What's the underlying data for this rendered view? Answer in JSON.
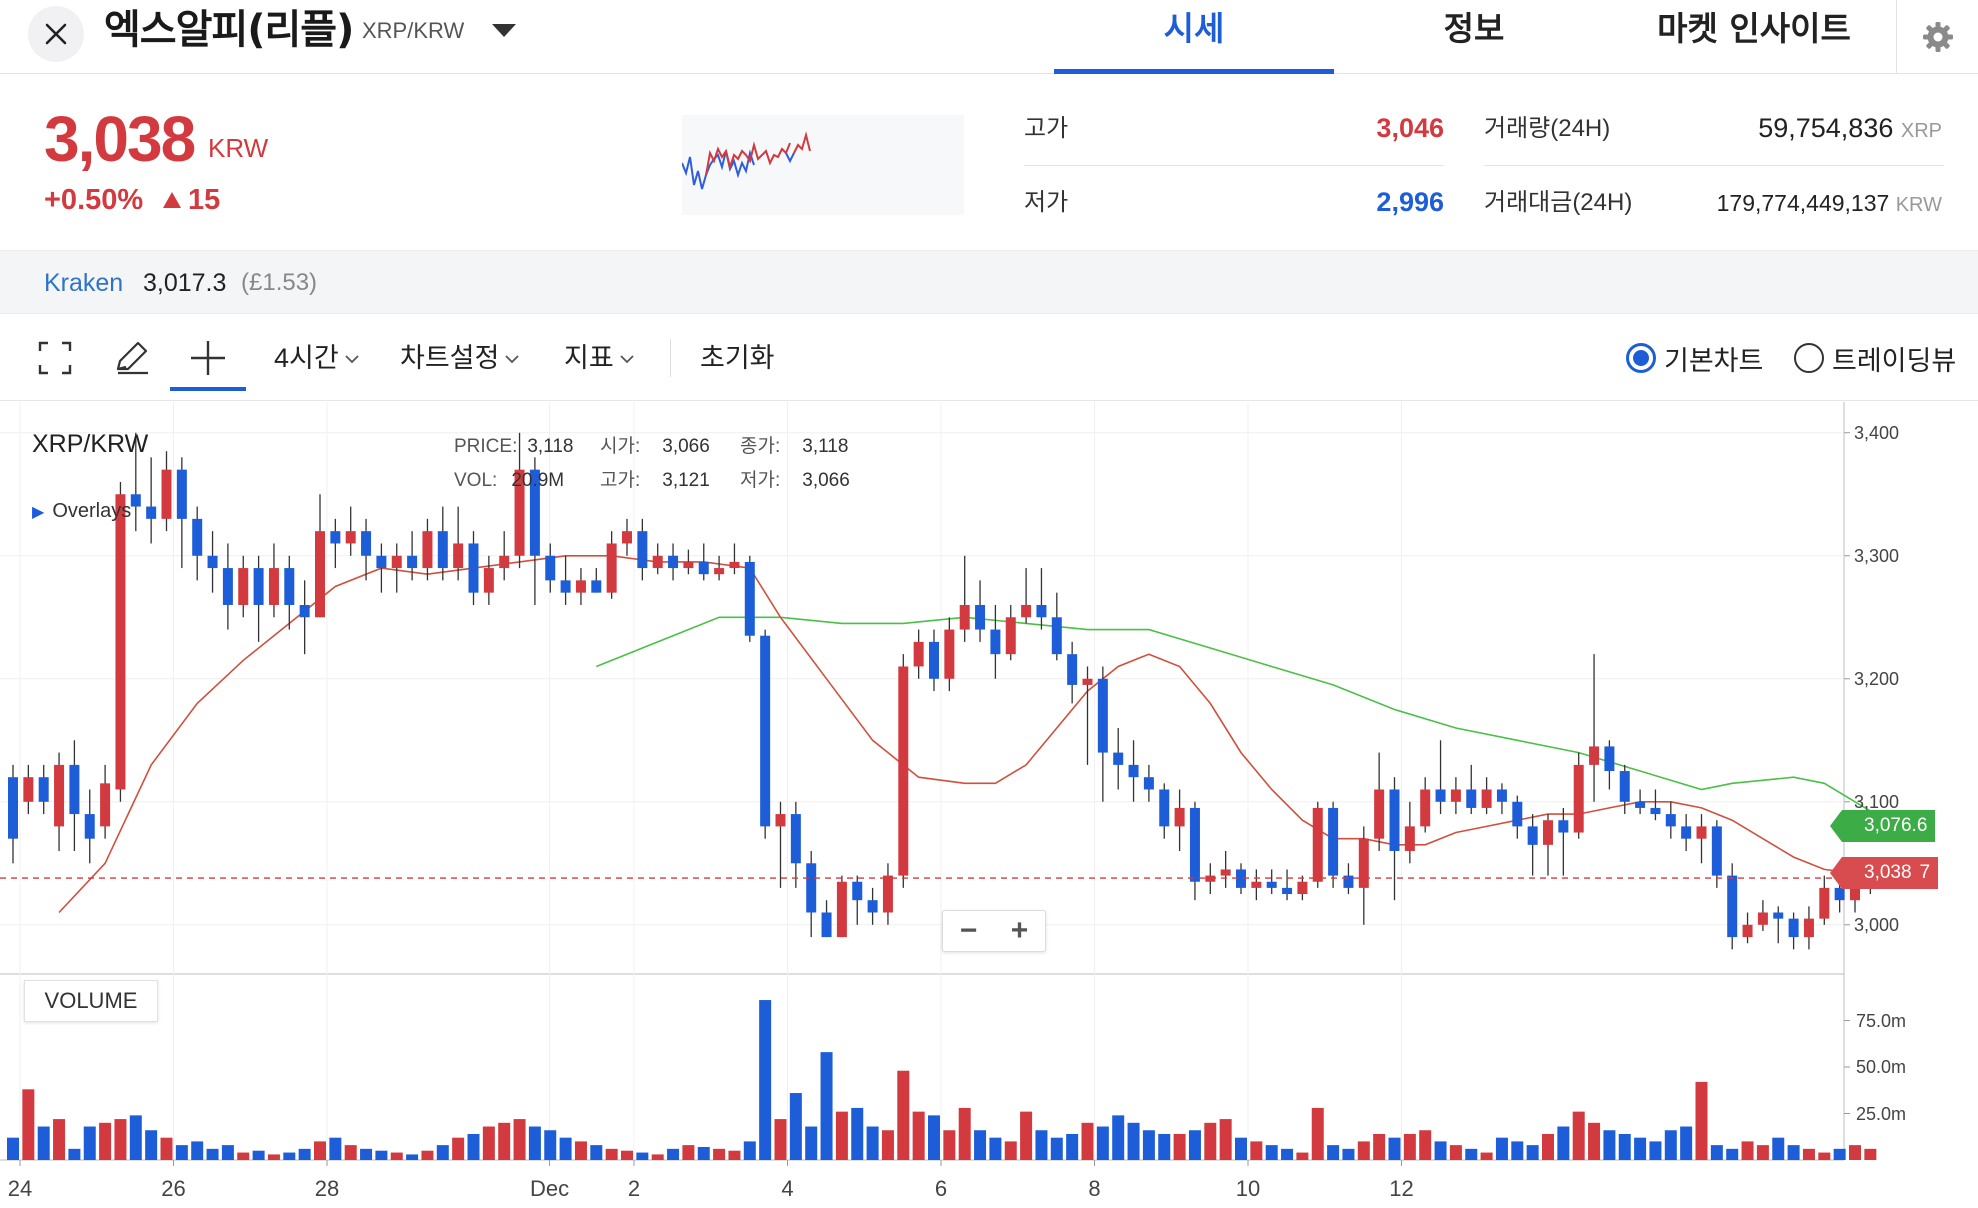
{
  "header": {
    "coin_name": "엑스알피(리플)",
    "pair": "XRP/KRW",
    "tabs": [
      {
        "label": "시세",
        "active": true
      },
      {
        "label": "정보",
        "active": false
      },
      {
        "label": "마켓 인사이트",
        "active": false
      }
    ]
  },
  "price": {
    "current": "3,038",
    "unit": "KRW",
    "change_pct": "+0.50%",
    "change_abs": "15",
    "high_label": "고가",
    "high_value": "3,046",
    "low_label": "저가",
    "low_value": "2,996",
    "volume_label": "거래량(24H)",
    "volume_value": "59,754,836",
    "volume_unit": "XRP",
    "amount_label": "거래대금(24H)",
    "amount_value": "179,774,449,137",
    "amount_unit": "KRW"
  },
  "exchange": {
    "name": "Kraken",
    "price": "3,017.3",
    "sub": "(£1.53)"
  },
  "toolbar": {
    "interval": "4시간",
    "chart_settings": "차트설정",
    "indicators": "지표",
    "reset": "초기화",
    "radio_basic": "기본차트",
    "radio_tradingview": "트레이딩뷰",
    "selected_view": "기본차트"
  },
  "chart": {
    "symbol": "XRP/KRW",
    "overlays_label": "Overlays",
    "ohlc": {
      "price_key": "PRICE:",
      "price": "3,118",
      "open_key": "시가:",
      "open": "3,066",
      "close_key": "종가:",
      "close": "3,118",
      "vol_key": "VOL:",
      "vol": "20.9M",
      "high_key": "고가:",
      "high": "3,121",
      "low_key": "저가:",
      "low": "3,066"
    },
    "volume_label": "VOLUME",
    "zoom_minus": "−",
    "zoom_plus": "+",
    "price_tag_ma": "3,076.6",
    "price_tag_last": "3,038",
    "price_tag_last_suffix": "7"
  },
  "colors": {
    "up": "#d23a3f",
    "down": "#1d5ed8",
    "accent": "#1d5ed8",
    "ma_short": "#d0503e",
    "ma_long": "#4bbf47"
  },
  "chart_data": {
    "type": "candlestick",
    "title": "XRP/KRW",
    "x_ticks": [
      "24",
      "26",
      "28",
      "Dec",
      "2",
      "4",
      "6",
      "8",
      "10",
      "12"
    ],
    "y_ticks": [
      "3,400",
      "3,300",
      "3,200",
      "3,100",
      "3,000"
    ],
    "volume_ticks": [
      "75.0m",
      "50.0m",
      "25.0m"
    ],
    "ylim": [
      2960,
      3425
    ],
    "volume_ylim": [
      0,
      100
    ],
    "current_price": 3038,
    "candles": [
      [
        3120,
        3070,
        3130,
        3050
      ],
      [
        3100,
        3120,
        3130,
        3090
      ],
      [
        3120,
        3100,
        3130,
        3090
      ],
      [
        3080,
        3130,
        3140,
        3060
      ],
      [
        3130,
        3090,
        3150,
        3060
      ],
      [
        3090,
        3070,
        3110,
        3050
      ],
      [
        3080,
        3115,
        3130,
        3070
      ],
      [
        3110,
        3350,
        3360,
        3100
      ],
      [
        3350,
        3340,
        3400,
        3320
      ],
      [
        3340,
        3330,
        3380,
        3310
      ],
      [
        3330,
        3370,
        3385,
        3320
      ],
      [
        3370,
        3330,
        3380,
        3290
      ],
      [
        3330,
        3300,
        3340,
        3280
      ],
      [
        3300,
        3290,
        3320,
        3270
      ],
      [
        3290,
        3260,
        3310,
        3240
      ],
      [
        3260,
        3290,
        3300,
        3250
      ],
      [
        3290,
        3260,
        3300,
        3230
      ],
      [
        3260,
        3290,
        3310,
        3250
      ],
      [
        3290,
        3260,
        3300,
        3240
      ],
      [
        3260,
        3250,
        3280,
        3220
      ],
      [
        3250,
        3320,
        3350,
        3250
      ],
      [
        3320,
        3310,
        3330,
        3290
      ],
      [
        3310,
        3320,
        3340,
        3300
      ],
      [
        3320,
        3300,
        3330,
        3280
      ],
      [
        3300,
        3290,
        3310,
        3270
      ],
      [
        3290,
        3300,
        3310,
        3270
      ],
      [
        3300,
        3290,
        3320,
        3280
      ],
      [
        3290,
        3320,
        3330,
        3280
      ],
      [
        3320,
        3290,
        3340,
        3280
      ],
      [
        3290,
        3310,
        3340,
        3280
      ],
      [
        3310,
        3270,
        3320,
        3260
      ],
      [
        3270,
        3290,
        3300,
        3260
      ],
      [
        3290,
        3300,
        3320,
        3280
      ],
      [
        3300,
        3370,
        3400,
        3290
      ],
      [
        3370,
        3300,
        3380,
        3260
      ],
      [
        3300,
        3280,
        3310,
        3270
      ],
      [
        3280,
        3270,
        3300,
        3260
      ],
      [
        3270,
        3280,
        3290,
        3260
      ],
      [
        3280,
        3270,
        3290,
        3270
      ],
      [
        3270,
        3310,
        3320,
        3265
      ],
      [
        3310,
        3320,
        3330,
        3300
      ],
      [
        3320,
        3290,
        3330,
        3280
      ],
      [
        3290,
        3300,
        3310,
        3285
      ],
      [
        3300,
        3290,
        3310,
        3280
      ],
      [
        3290,
        3295,
        3305,
        3285
      ],
      [
        3295,
        3285,
        3310,
        3280
      ],
      [
        3285,
        3290,
        3300,
        3280
      ],
      [
        3290,
        3295,
        3310,
        3285
      ],
      [
        3295,
        3235,
        3300,
        3230
      ],
      [
        3235,
        3080,
        3240,
        3070
      ],
      [
        3080,
        3090,
        3100,
        3030
      ],
      [
        3090,
        3050,
        3100,
        3030
      ],
      [
        3050,
        3010,
        3060,
        2990
      ],
      [
        3010,
        2990,
        3020,
        2990
      ],
      [
        2990,
        3035,
        3040,
        2990
      ],
      [
        3035,
        3020,
        3040,
        3000
      ],
      [
        3020,
        3010,
        3030,
        3000
      ],
      [
        3010,
        3040,
        3050,
        3000
      ],
      [
        3040,
        3210,
        3220,
        3030
      ],
      [
        3210,
        3230,
        3240,
        3200
      ],
      [
        3230,
        3200,
        3240,
        3190
      ],
      [
        3200,
        3240,
        3250,
        3190
      ],
      [
        3240,
        3260,
        3300,
        3230
      ],
      [
        3260,
        3240,
        3280,
        3230
      ],
      [
        3240,
        3220,
        3260,
        3200
      ],
      [
        3220,
        3250,
        3260,
        3215
      ],
      [
        3250,
        3260,
        3290,
        3245
      ],
      [
        3260,
        3250,
        3290,
        3240
      ],
      [
        3250,
        3220,
        3270,
        3215
      ],
      [
        3220,
        3195,
        3230,
        3180
      ],
      [
        3195,
        3200,
        3210,
        3130
      ],
      [
        3200,
        3140,
        3210,
        3100
      ],
      [
        3140,
        3130,
        3160,
        3110
      ],
      [
        3130,
        3120,
        3150,
        3100
      ],
      [
        3120,
        3110,
        3130,
        3100
      ],
      [
        3110,
        3080,
        3115,
        3070
      ],
      [
        3080,
        3095,
        3110,
        3060
      ],
      [
        3095,
        3035,
        3100,
        3020
      ],
      [
        3035,
        3040,
        3050,
        3025
      ],
      [
        3040,
        3045,
        3060,
        3030
      ],
      [
        3045,
        3030,
        3050,
        3025
      ],
      [
        3030,
        3035,
        3045,
        3020
      ],
      [
        3035,
        3030,
        3045,
        3025
      ],
      [
        3030,
        3025,
        3045,
        3020
      ],
      [
        3025,
        3035,
        3040,
        3020
      ],
      [
        3035,
        3095,
        3100,
        3030
      ],
      [
        3095,
        3040,
        3100,
        3030
      ],
      [
        3040,
        3030,
        3050,
        3025
      ],
      [
        3030,
        3070,
        3080,
        3000
      ],
      [
        3070,
        3110,
        3140,
        3060
      ],
      [
        3110,
        3060,
        3120,
        3020
      ],
      [
        3060,
        3080,
        3100,
        3050
      ],
      [
        3080,
        3110,
        3120,
        3075
      ],
      [
        3110,
        3100,
        3150,
        3090
      ],
      [
        3100,
        3110,
        3120,
        3090
      ],
      [
        3110,
        3095,
        3130,
        3090
      ],
      [
        3095,
        3110,
        3120,
        3090
      ],
      [
        3110,
        3100,
        3115,
        3090
      ],
      [
        3100,
        3080,
        3105,
        3070
      ],
      [
        3080,
        3065,
        3090,
        3040
      ],
      [
        3065,
        3085,
        3090,
        3040
      ],
      [
        3085,
        3075,
        3095,
        3040
      ],
      [
        3075,
        3130,
        3140,
        3070
      ],
      [
        3130,
        3145,
        3220,
        3100
      ],
      [
        3145,
        3125,
        3150,
        3110
      ],
      [
        3125,
        3100,
        3130,
        3090
      ],
      [
        3100,
        3095,
        3110,
        3090
      ],
      [
        3095,
        3090,
        3110,
        3085
      ],
      [
        3090,
        3080,
        3100,
        3070
      ],
      [
        3080,
        3070,
        3090,
        3060
      ],
      [
        3070,
        3080,
        3090,
        3050
      ],
      [
        3080,
        3040,
        3085,
        3030
      ],
      [
        3040,
        2990,
        3050,
        2980
      ],
      [
        2990,
        3000,
        3010,
        2985
      ],
      [
        3000,
        3010,
        3020,
        2995
      ],
      [
        3010,
        3005,
        3015,
        2985
      ],
      [
        3005,
        2990,
        3010,
        2980
      ],
      [
        2990,
        3005,
        3015,
        2980
      ],
      [
        3005,
        3030,
        3040,
        3000
      ],
      [
        3030,
        3020,
        3040,
        3010
      ],
      [
        3020,
        3030,
        3040,
        3010
      ],
      [
        3030,
        3040,
        3050,
        3025
      ]
    ],
    "volumes": [
      12,
      38,
      18,
      22,
      6,
      18,
      20,
      22,
      24,
      16,
      12,
      8,
      10,
      6,
      8,
      4,
      5,
      3,
      4,
      6,
      10,
      12,
      8,
      6,
      5,
      4,
      3,
      5,
      8,
      12,
      14,
      18,
      20,
      22,
      18,
      16,
      12,
      10,
      8,
      6,
      5,
      4,
      3,
      6,
      8,
      7,
      6,
      5,
      10,
      86,
      22,
      36,
      18,
      58,
      26,
      28,
      18,
      16,
      48,
      26,
      24,
      16,
      28,
      16,
      12,
      10,
      26,
      16,
      12,
      14,
      20,
      18,
      24,
      20,
      16,
      14,
      14,
      16,
      20,
      22,
      12,
      10,
      8,
      6,
      4,
      28,
      8,
      6,
      10,
      14,
      12,
      14,
      16,
      10,
      8,
      6,
      4,
      12,
      10,
      8,
      14,
      18,
      26,
      20,
      16,
      14,
      12,
      10,
      16,
      18,
      42,
      8,
      6,
      10,
      8,
      12,
      8,
      6,
      4,
      6,
      8,
      6
    ],
    "ma_short": [
      [
        3,
        3010
      ],
      [
        6,
        3050
      ],
      [
        9,
        3130
      ],
      [
        12,
        3180
      ],
      [
        15,
        3215
      ],
      [
        18,
        3245
      ],
      [
        21,
        3275
      ],
      [
        24,
        3290
      ],
      [
        27,
        3285
      ],
      [
        30,
        3290
      ],
      [
        33,
        3295
      ],
      [
        36,
        3300
      ],
      [
        39,
        3300
      ],
      [
        42,
        3295
      ],
      [
        45,
        3295
      ],
      [
        48,
        3290
      ],
      [
        50,
        3250
      ],
      [
        53,
        3200
      ],
      [
        56,
        3150
      ],
      [
        59,
        3120
      ],
      [
        62,
        3115
      ],
      [
        64,
        3115
      ],
      [
        66,
        3130
      ],
      [
        68,
        3160
      ],
      [
        70,
        3190
      ],
      [
        72,
        3210
      ],
      [
        74,
        3220
      ],
      [
        76,
        3210
      ],
      [
        78,
        3180
      ],
      [
        80,
        3140
      ],
      [
        82,
        3110
      ],
      [
        84,
        3085
      ],
      [
        86,
        3070
      ],
      [
        88,
        3070
      ],
      [
        90,
        3065
      ],
      [
        92,
        3065
      ],
      [
        94,
        3075
      ],
      [
        96,
        3080
      ],
      [
        98,
        3085
      ],
      [
        100,
        3090
      ],
      [
        102,
        3090
      ],
      [
        104,
        3095
      ],
      [
        106,
        3100
      ],
      [
        108,
        3100
      ],
      [
        110,
        3095
      ],
      [
        112,
        3085
      ],
      [
        114,
        3070
      ],
      [
        116,
        3055
      ],
      [
        118,
        3045
      ],
      [
        121,
        3040
      ]
    ],
    "ma_long": [
      [
        38,
        3210
      ],
      [
        42,
        3230
      ],
      [
        46,
        3250
      ],
      [
        50,
        3250
      ],
      [
        54,
        3245
      ],
      [
        58,
        3245
      ],
      [
        62,
        3250
      ],
      [
        66,
        3245
      ],
      [
        70,
        3240
      ],
      [
        74,
        3240
      ],
      [
        78,
        3225
      ],
      [
        82,
        3210
      ],
      [
        86,
        3195
      ],
      [
        90,
        3175
      ],
      [
        94,
        3160
      ],
      [
        98,
        3150
      ],
      [
        102,
        3140
      ],
      [
        106,
        3125
      ],
      [
        110,
        3110
      ],
      [
        112,
        3115
      ],
      [
        116,
        3120
      ],
      [
        118,
        3115
      ],
      [
        120,
        3100
      ],
      [
        122,
        3085
      ],
      [
        124,
        3075
      ]
    ]
  }
}
